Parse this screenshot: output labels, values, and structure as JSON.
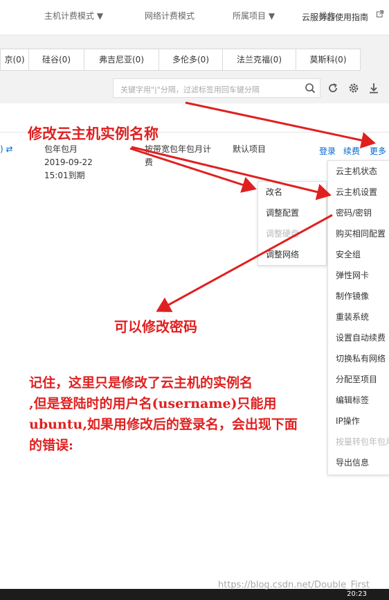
{
  "header": {
    "guide_link": "云服务器使用指南"
  },
  "regions": [
    "京(0)",
    "硅谷(0)",
    "弗吉尼亚(0)",
    "多伦多(0)",
    "法兰克福(0)",
    "莫斯科(0)"
  ],
  "search": {
    "placeholder": "关键字用\"|\"分隔，过滤标签用回车键分隔"
  },
  "table": {
    "headers": {
      "billing": "主机计费模式",
      "network": "网络计费模式",
      "project": "所属项目",
      "ops": "操作"
    },
    "row": {
      "billing": [
        "包年包月",
        "2019-09-22",
        "15:01到期"
      ],
      "network": [
        "按带宽包年包月计",
        "费"
      ],
      "project": "默认项目",
      "actions": [
        "登录",
        "续费",
        "更多"
      ]
    }
  },
  "submenu": [
    "改名",
    "调整配置",
    "调整硬盘",
    "调整网络"
  ],
  "more_menu": [
    "云主机状态",
    "云主机设置",
    "密码/密钥",
    "购买相同配置",
    "安全组",
    "弹性网卡",
    "制作镜像",
    "重装系统",
    "设置自动续费",
    "切换私有网络",
    "分配至项目",
    "编辑标签",
    "IP操作",
    "按量转包年包月",
    "导出信息"
  ],
  "annotations": {
    "rename": "修改云主机实例名称",
    "password": "可以修改密码",
    "note_lines": [
      "记住，这里只是修改了云主机的实例名",
      ",但是登陆时的用户名(username)只能用",
      "ubuntu,如果用修改后的登录名，会出现下面",
      "的错误:"
    ]
  },
  "footer": {
    "watermark": "https://blog.csdn.net/Double_First",
    "clock": "20:23"
  },
  "colors": {
    "annotation_red": "#e02020",
    "link_blue": "#0066cc",
    "panel_gray": "#f2f2f2"
  }
}
